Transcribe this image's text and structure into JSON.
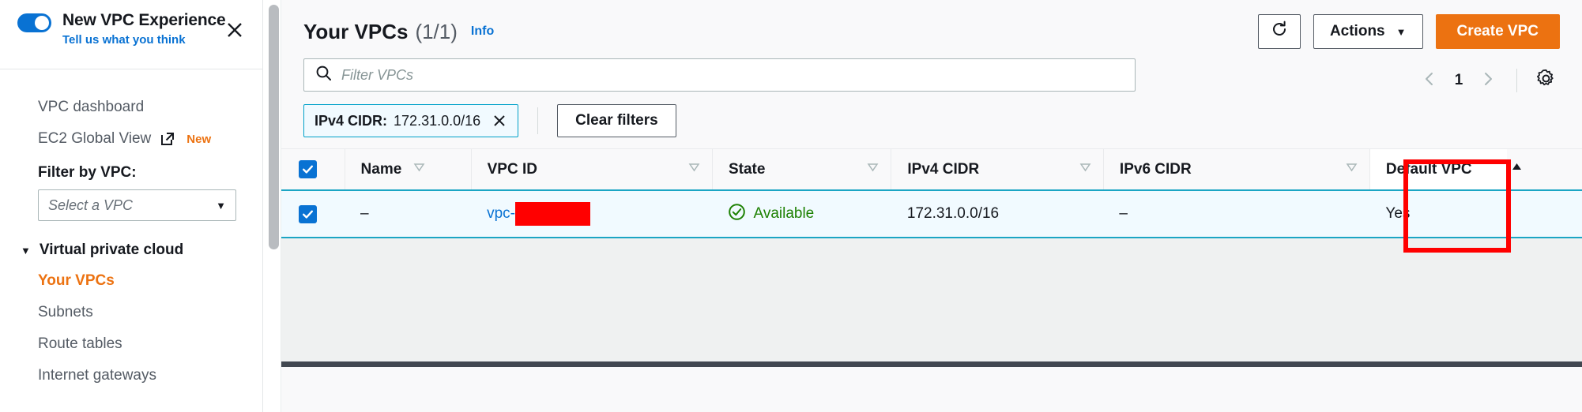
{
  "sidebar": {
    "toggle_label": "New VPC Experience",
    "toggle_state": "on",
    "feedback_link": "Tell us what you think",
    "close_icon": "close-icon",
    "links": [
      {
        "label": "VPC dashboard"
      },
      {
        "label": "EC2 Global View",
        "external": true,
        "badge": "New"
      }
    ],
    "filter_label": "Filter by VPC:",
    "filter_select_placeholder": "Select a VPC",
    "group": {
      "label": "Virtual private cloud",
      "expanded": true
    },
    "sub_items": [
      {
        "label": "Your VPCs",
        "active": true
      },
      {
        "label": "Subnets",
        "active": false
      },
      {
        "label": "Route tables",
        "active": false
      },
      {
        "label": "Internet gateways",
        "active": false
      }
    ]
  },
  "header": {
    "title": "Your VPCs",
    "count": "(1/1)",
    "info_label": "Info",
    "refresh_icon": "refresh-icon",
    "actions_label": "Actions",
    "create_label": "Create VPC"
  },
  "search": {
    "placeholder": "Filter VPCs",
    "value": "",
    "icon": "search-icon"
  },
  "filters": {
    "token_key": "IPv4 CIDR:",
    "token_value": "172.31.0.0/16",
    "token_close_icon": "close-icon",
    "clear_label": "Clear filters"
  },
  "pagination": {
    "prev_icon": "chevron-left-icon",
    "page": "1",
    "next_icon": "chevron-right-icon",
    "settings_icon": "gear-icon"
  },
  "table": {
    "columns": [
      {
        "label": "Name",
        "sort": "unsorted"
      },
      {
        "label": "VPC ID",
        "sort": "unsorted"
      },
      {
        "label": "State",
        "sort": "unsorted"
      },
      {
        "label": "IPv4 CIDR",
        "sort": "unsorted"
      },
      {
        "label": "IPv6 CIDR",
        "sort": "unsorted"
      },
      {
        "label": "Default VPC",
        "sort": "asc"
      }
    ],
    "select_all_checked": true,
    "rows": [
      {
        "selected": true,
        "name": "–",
        "vpc_id_prefix": "vpc-",
        "vpc_id_redacted": true,
        "state": "Available",
        "state_icon": "status-available-icon",
        "ipv4_cidr": "172.31.0.0/16",
        "ipv6_cidr": "–",
        "default_vpc": "Yes"
      }
    ]
  },
  "colors": {
    "accent_orange": "#ec7211",
    "link_blue": "#0972d3",
    "selected_row_bg": "#f1faff",
    "selected_row_border": "#1ba5c4",
    "status_green": "#1d8102",
    "annotation_red": "#ff0000",
    "redaction_red": "#ff0000"
  }
}
